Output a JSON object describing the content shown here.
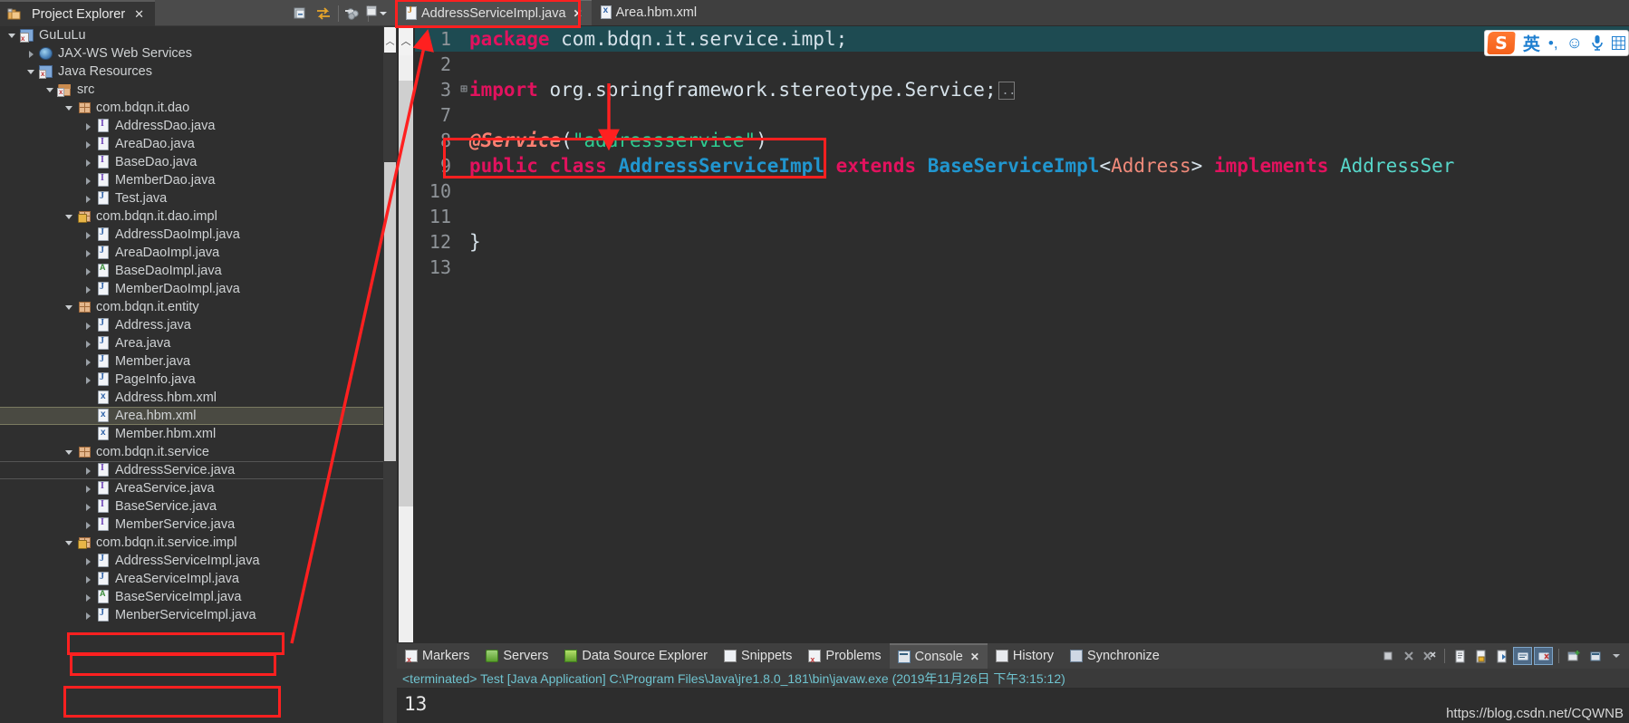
{
  "explorer": {
    "tab_label": "Project Explorer",
    "tab_close": "✕",
    "toolbar": [
      "collapse-all-icon",
      "link-with-editor-icon",
      "view-menu-icon",
      "chevron-down-icon"
    ],
    "tree": [
      {
        "label": "GuLuLu",
        "indent": 0,
        "arrow": "open",
        "icon": "project-icon"
      },
      {
        "label": "JAX-WS Web Services",
        "indent": 1,
        "arrow": "closed",
        "icon": "jaxws-icon"
      },
      {
        "label": "Java Resources",
        "indent": 1,
        "arrow": "open",
        "icon": "java-resources-icon"
      },
      {
        "label": "src",
        "indent": 2,
        "arrow": "open",
        "icon": "source-folder-icon"
      },
      {
        "label": "com.bdqn.it.dao",
        "indent": 3,
        "arrow": "open",
        "icon": "package-icon"
      },
      {
        "label": "AddressDao.java",
        "indent": 4,
        "arrow": "closed",
        "icon": "java-interface-icon"
      },
      {
        "label": "AreaDao.java",
        "indent": 4,
        "arrow": "closed",
        "icon": "java-interface-icon"
      },
      {
        "label": "BaseDao.java",
        "indent": 4,
        "arrow": "closed",
        "icon": "java-interface-icon"
      },
      {
        "label": "MemberDao.java",
        "indent": 4,
        "arrow": "closed",
        "icon": "java-interface-icon"
      },
      {
        "label": "Test.java",
        "indent": 4,
        "arrow": "closed",
        "icon": "java-file-icon"
      },
      {
        "label": "com.bdqn.it.dao.impl",
        "indent": 3,
        "arrow": "open",
        "icon": "package-lock-icon"
      },
      {
        "label": "AddressDaoImpl.java",
        "indent": 4,
        "arrow": "closed",
        "icon": "java-file-icon"
      },
      {
        "label": "AreaDaoImpl.java",
        "indent": 4,
        "arrow": "closed",
        "icon": "java-file-icon"
      },
      {
        "label": "BaseDaoImpl.java",
        "indent": 4,
        "arrow": "closed",
        "icon": "java-abstract-icon"
      },
      {
        "label": "MemberDaoImpl.java",
        "indent": 4,
        "arrow": "closed",
        "icon": "java-file-icon"
      },
      {
        "label": "com.bdqn.it.entity",
        "indent": 3,
        "arrow": "open",
        "icon": "package-icon"
      },
      {
        "label": "Address.java",
        "indent": 4,
        "arrow": "closed",
        "icon": "java-file-icon"
      },
      {
        "label": "Area.java",
        "indent": 4,
        "arrow": "closed",
        "icon": "java-file-icon"
      },
      {
        "label": "Member.java",
        "indent": 4,
        "arrow": "closed",
        "icon": "java-file-icon"
      },
      {
        "label": "PageInfo.java",
        "indent": 4,
        "arrow": "closed",
        "icon": "java-file-icon"
      },
      {
        "label": "Address.hbm.xml",
        "indent": 4,
        "arrow": "none",
        "icon": "xml-file-icon"
      },
      {
        "label": "Area.hbm.xml",
        "indent": 4,
        "arrow": "none",
        "icon": "xml-file-icon",
        "state": "selected"
      },
      {
        "label": "Member.hbm.xml",
        "indent": 4,
        "arrow": "none",
        "icon": "xml-file-icon"
      },
      {
        "label": "com.bdqn.it.service",
        "indent": 3,
        "arrow": "open",
        "icon": "package-icon"
      },
      {
        "label": "AddressService.java",
        "indent": 4,
        "arrow": "closed",
        "icon": "java-interface-icon",
        "state": "outlined"
      },
      {
        "label": "AreaService.java",
        "indent": 4,
        "arrow": "closed",
        "icon": "java-interface-icon"
      },
      {
        "label": "BaseService.java",
        "indent": 4,
        "arrow": "closed",
        "icon": "java-interface-icon"
      },
      {
        "label": "MemberService.java",
        "indent": 4,
        "arrow": "closed",
        "icon": "java-interface-icon"
      },
      {
        "label": "com.bdqn.it.service.impl",
        "indent": 3,
        "arrow": "open",
        "icon": "package-lock-icon"
      },
      {
        "label": "AddressServiceImpl.java",
        "indent": 4,
        "arrow": "closed",
        "icon": "java-file-icon"
      },
      {
        "label": "AreaServiceImpl.java",
        "indent": 4,
        "arrow": "closed",
        "icon": "java-file-icon"
      },
      {
        "label": "BaseServiceImpl.java",
        "indent": 4,
        "arrow": "closed",
        "icon": "java-abstract-icon"
      },
      {
        "label": "MenberServiceImpl.java",
        "indent": 4,
        "arrow": "closed",
        "icon": "java-file-icon"
      }
    ],
    "scrollbar": {
      "up_arrow": "︿"
    }
  },
  "editor": {
    "tabs": [
      {
        "label": "AddressServiceImpl.java",
        "icon": "java-file-icon",
        "close": "✕",
        "active": true
      },
      {
        "label": "Area.hbm.xml",
        "icon": "xml-file-icon",
        "close": "",
        "active": false
      }
    ],
    "minimize_icon": "minimize-icon",
    "maximize_icon": "maximize-icon",
    "scroll_up_arrow": "︿",
    "lines": [
      {
        "n": "1",
        "fold": "",
        "highlight": true,
        "tokens": [
          {
            "t": "package",
            "c": "kw"
          },
          {
            "t": " com.bdqn.it.service.impl;",
            "c": "pln"
          }
        ]
      },
      {
        "n": "2",
        "fold": "",
        "highlight": false,
        "tokens": []
      },
      {
        "n": "3",
        "fold": "⊞",
        "highlight": false,
        "tokens": [
          {
            "t": "import",
            "c": "kw"
          },
          {
            "t": " org.springframework.stereotype.Service;",
            "c": "pln"
          },
          {
            "t": "FOLDBOX",
            "c": "foldbox"
          }
        ]
      },
      {
        "n": "7",
        "fold": "",
        "highlight": false,
        "tokens": []
      },
      {
        "n": "8",
        "fold": "",
        "highlight": false,
        "tokens": [
          {
            "t": "@Service",
            "c": "ann"
          },
          {
            "t": "(",
            "c": "pln"
          },
          {
            "t": "\"addressservice\"",
            "c": "str"
          },
          {
            "t": ")",
            "c": "pln"
          }
        ]
      },
      {
        "n": "9",
        "fold": "",
        "highlight": false,
        "tokens": [
          {
            "t": "public class",
            "c": "kw"
          },
          {
            "t": " ",
            "c": "pln"
          },
          {
            "t": "AddressServiceImpl",
            "c": "typ"
          },
          {
            "t": " ",
            "c": "pln"
          },
          {
            "t": "extends",
            "c": "kw"
          },
          {
            "t": " ",
            "c": "pln"
          },
          {
            "t": "BaseServiceImpl",
            "c": "typ"
          },
          {
            "t": "<",
            "c": "pln"
          },
          {
            "t": "Address",
            "c": "gen"
          },
          {
            "t": ">",
            "c": "pln"
          },
          {
            "t": " ",
            "c": "pln"
          },
          {
            "t": "implements",
            "c": "kw"
          },
          {
            "t": " ",
            "c": "pln"
          },
          {
            "t": "AddressSer",
            "c": "typ2"
          }
        ]
      },
      {
        "n": "10",
        "fold": "",
        "highlight": false,
        "tokens": []
      },
      {
        "n": "11",
        "fold": "",
        "highlight": false,
        "tokens": []
      },
      {
        "n": "12",
        "fold": "",
        "highlight": false,
        "tokens": [
          {
            "t": "}",
            "c": "pln"
          }
        ]
      },
      {
        "n": "13",
        "fold": "",
        "highlight": false,
        "tokens": []
      }
    ]
  },
  "bottom_panel": {
    "tabs": [
      {
        "label": "Markers",
        "icon": "markers-icon",
        "active": false
      },
      {
        "label": "Servers",
        "icon": "servers-icon",
        "active": false
      },
      {
        "label": "Data Source Explorer",
        "icon": "data-source-icon",
        "active": false
      },
      {
        "label": "Snippets",
        "icon": "snippets-icon",
        "active": false
      },
      {
        "label": "Problems",
        "icon": "problems-icon",
        "active": false
      },
      {
        "label": "Console",
        "icon": "console-icon",
        "active": true,
        "close": "✕"
      },
      {
        "label": "History",
        "icon": "history-icon",
        "active": false
      },
      {
        "label": "Synchronize",
        "icon": "synchronize-icon",
        "active": false
      }
    ],
    "toolbar": [
      "terminate-icon",
      "remove-launch-icon",
      "remove-all-launches-icon",
      "sep",
      "open-console-icon",
      "display-selected-console-icon",
      "pin-console-icon",
      "scroll-lock-icon",
      "clear-console-icon",
      "sep",
      "new-console-view-icon",
      "open-console-menu-icon",
      "chevron-down-icon"
    ],
    "status_line": "<terminated> Test [Java Application] C:\\Program Files\\Java\\jre1.8.0_181\\bin\\javaw.exe (2019年11月26日 下午3:15:12)",
    "console_output": "13",
    "watermark": "https://blog.csdn.net/CQWNB"
  },
  "ime_toolbar": {
    "logo": "S",
    "items": [
      "英",
      "•,",
      "☺",
      "🎤",
      "▦"
    ]
  },
  "annotations": {
    "color": "#ff2020",
    "boxes": [
      {
        "name": "tab-highlight-box"
      },
      {
        "name": "service-annotation-box"
      },
      {
        "name": "address-service-impl-box"
      },
      {
        "name": "area-service-impl-box"
      },
      {
        "name": "menber-service-impl-box"
      }
    ],
    "arrows": [
      {
        "name": "tree-to-tab-arrow"
      },
      {
        "name": "import-to-annotation-arrow"
      }
    ]
  }
}
